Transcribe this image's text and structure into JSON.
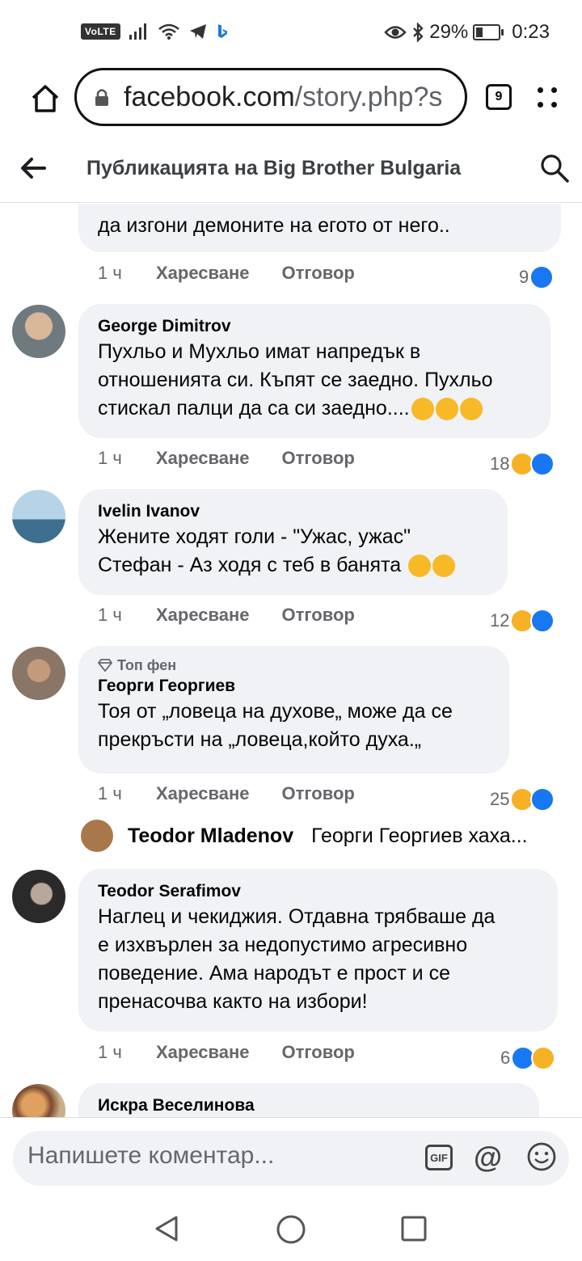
{
  "status_bar": {
    "volte": "VoLTE",
    "battery": "29%",
    "time": "0:23",
    "icons": [
      "signal-icon",
      "wifi-icon",
      "telegram-icon",
      "bing-icon",
      "eye-icon",
      "bluetooth-icon",
      "battery-icon"
    ]
  },
  "browser": {
    "url_host": "facebook.com",
    "url_path": "/story.php?s",
    "tab_count": "9"
  },
  "header": {
    "title": "Публикацията на Big Brother Bulgaria"
  },
  "comments": [
    {
      "text": "да изгони демоните на егото от него..",
      "time": "1 ч",
      "like": "Харесване",
      "reply": "Отговор",
      "reactions": "9"
    },
    {
      "name": "George Dimitrov",
      "text_lines": [
        "Пухльо и Мухльо имат напредък в",
        "отношенията си. Къпят се заедно. Пухльо",
        "стискал палци да са си заедно...."
      ],
      "time": "1 ч",
      "like": "Харесване",
      "reply": "Отговор",
      "reactions": "18"
    },
    {
      "name": "Ivelin Ivanov",
      "text_lines": [
        "Жените ходят голи - \"Ужас, ужас\"",
        "Стефан - Аз ходя с теб в банята"
      ],
      "time": "1 ч",
      "like": "Харесване",
      "reply": "Отговор",
      "reactions": "12"
    },
    {
      "badge": "Топ фен",
      "name": "Георги Георгиев",
      "text_lines": [
        "Тоя от „ловеца на духове„ може да се",
        "прекръсти на „ловеца,който духа.„"
      ],
      "time": "1 ч",
      "like": "Харесване",
      "reply": "Отговор",
      "reactions": "25"
    },
    {
      "name": "Teodor Serafimov",
      "text_lines": [
        "Наглец и чекиджия. Отдавна трябваше да",
        "е изхвърлен за недопустимо агресивно",
        "поведение. Ама народът е прост и се",
        "пренасочва както на избори!"
      ],
      "time": "1 ч",
      "like": "Харесване",
      "reply": "Отговор",
      "reactions": "6"
    },
    {
      "name": "Искра Веселинова"
    }
  ],
  "reply_preview": {
    "name": "Teodor Mladenov",
    "text": "Георги Георгиев хаха..."
  },
  "composer": {
    "placeholder": "Напишете коментар...",
    "gif": "GIF",
    "at": "@"
  },
  "colors": {
    "bubble": "#f0f2f5",
    "like_blue": "#1877f2",
    "haha_yellow": "#f7b125",
    "meta_gray": "#65676b"
  }
}
